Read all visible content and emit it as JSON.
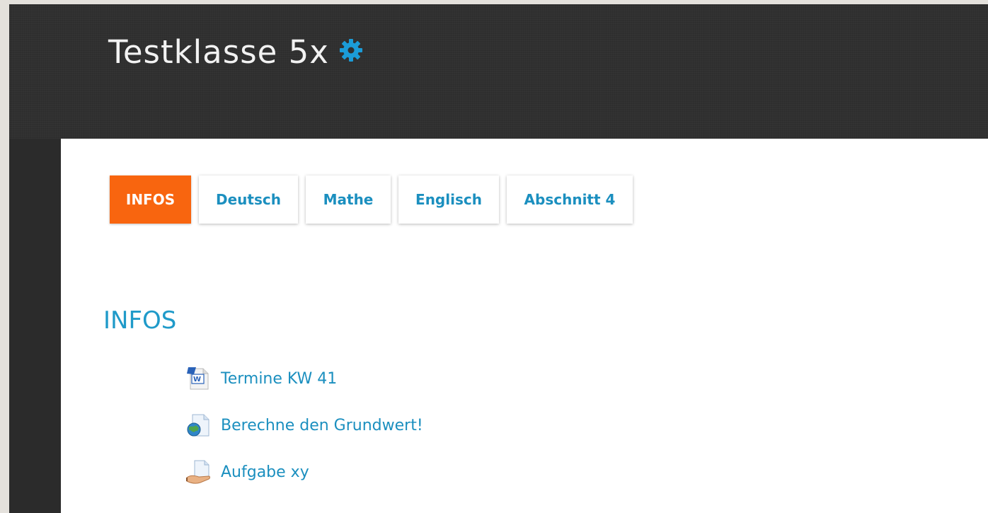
{
  "header": {
    "course_title": "Testklasse 5x",
    "settings_icon": "gear-icon",
    "accent_color": "#1b9cd8"
  },
  "tabs": [
    {
      "label": "INFOS",
      "active": true
    },
    {
      "label": "Deutsch",
      "active": false
    },
    {
      "label": "Mathe",
      "active": false
    },
    {
      "label": "Englisch",
      "active": false
    },
    {
      "label": "Abschnitt 4",
      "active": false
    }
  ],
  "section": {
    "title": "INFOS",
    "activities": [
      {
        "label": "Termine KW 41",
        "icon": "word-document-icon"
      },
      {
        "label": "Berechne den Grundwert!",
        "icon": "url-globe-icon"
      },
      {
        "label": "Aufgabe xy",
        "icon": "assignment-icon"
      }
    ]
  },
  "colors": {
    "active_tab": "#f8650f",
    "link": "#1b8fbf",
    "header_bg": "#303030"
  }
}
